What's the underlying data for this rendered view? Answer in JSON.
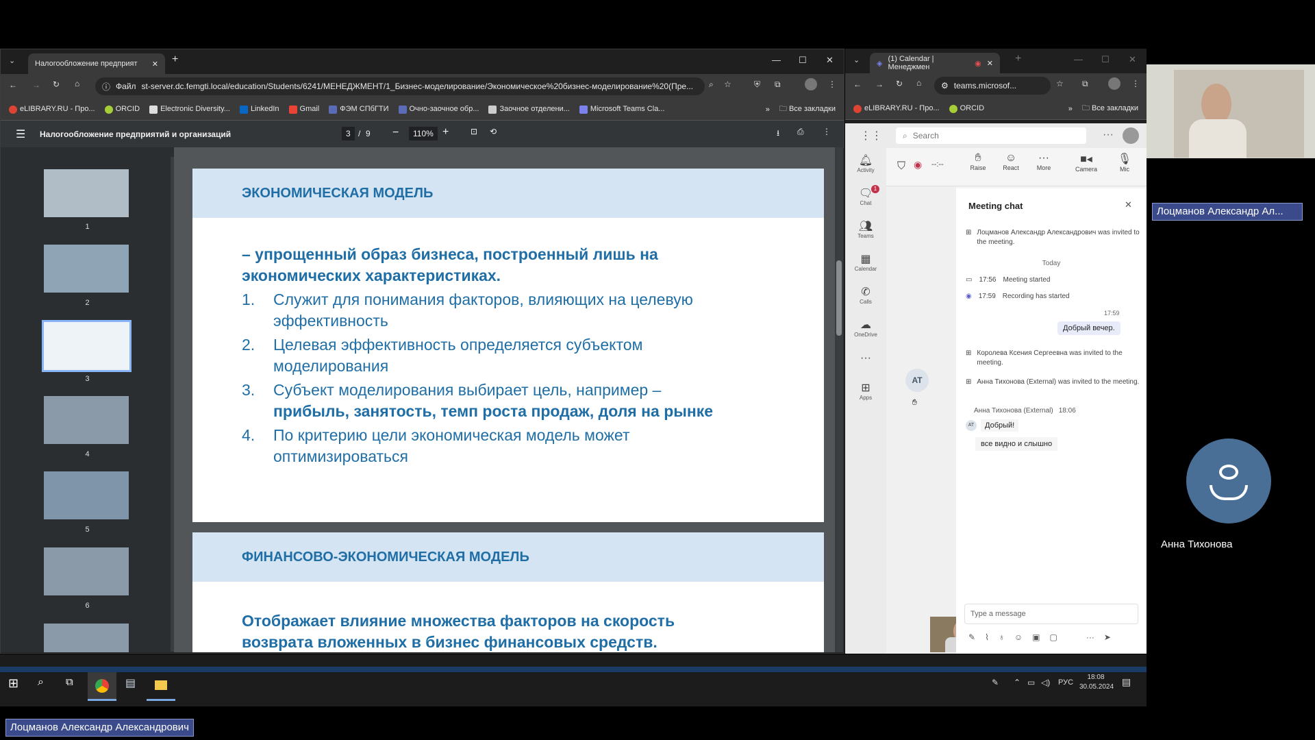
{
  "left_browser": {
    "tab_title": "Налогообложение предприят",
    "address": "st-server.dc.femgti.local/education/Students/6241/МЕНЕДЖМЕНТ/1_Бизнес-моделирование/Экономическое%20бизнес-моделирование%20(Пре...",
    "address_prefix": "Файл",
    "bookmarks": [
      "eLIBRARY.RU - Про...",
      "ORCID",
      "Electronic Diversity...",
      "LinkedIn",
      "Gmail",
      "ФЭМ СПбГТИ",
      "Очно-заочное обр...",
      "Заочное отделени...",
      "Microsoft Teams Cla..."
    ],
    "bookmarks_all": "Все закладки",
    "pdf_title": "Налогообложение предприятий и организаций",
    "page_current": "3",
    "page_total": "9",
    "zoom": "110%",
    "thumb_numbers": [
      "1",
      "2",
      "3",
      "4",
      "5",
      "6"
    ]
  },
  "slide1": {
    "heading": "ЭКОНОМИЧЕСКАЯ МОДЕЛЬ",
    "lead": "– упрощенный образ бизнеса, построенный лишь на экономических характеристиках.",
    "items": [
      {
        "n": "1.",
        "text": "Служит для понимания факторов, влияющих на целевую эффективность"
      },
      {
        "n": "2.",
        "text": "Целевая эффективность определяется субъектом моделирования"
      },
      {
        "n": "3.",
        "text": "Субъект моделирования выбирает цель, например –",
        "bold": "прибыль, занятость, темп роста продаж, доля на рынке"
      },
      {
        "n": "4.",
        "text": "По критерию цели экономическая модель может оптимизироваться"
      }
    ]
  },
  "slide2": {
    "heading": "ФИНАНСОВО-ЭКОНОМИЧЕСКАЯ МОДЕЛЬ",
    "lead": "Отображает влияние множества факторов на скорость возврата вложенных в бизнес финансовых средств."
  },
  "right_browser": {
    "tab_title": "(1) Calendar | Менеджмен",
    "address": "teams.microsof...",
    "bookmarks": [
      "eLIBRARY.RU - Про...",
      "ORCID"
    ],
    "bookmarks_all": "Все закладки"
  },
  "teams": {
    "search_placeholder": "Search",
    "timer": "--:--",
    "rail": [
      "Activity",
      "Chat",
      "Teams",
      "Calendar",
      "Calls",
      "OneDrive",
      "Apps"
    ],
    "chat_badge": "1",
    "toolbar": [
      "Raise",
      "React",
      "More",
      "Camera",
      "Mic"
    ],
    "participant_initials": "AT",
    "chat": {
      "title": "Meeting chat",
      "invite1": "Лоцманов Александр Александрович was invited to the meeting.",
      "today": "Today",
      "ev1_time": "17:56",
      "ev1_text": "Meeting started",
      "ev2_time": "17:59",
      "ev2_text": "Recording has started",
      "my_time": "17:59",
      "my_msg": "Добрый вечер.",
      "invite2": "Королева Ксения Сергеевна was invited to the meeting.",
      "invite3": "Анна Тихонова (External) was invited to the meeting.",
      "sender": "Анна Тихонова (External)",
      "sender_time": "18:06",
      "msg1": "Добрый!",
      "msg2": "все видно и слышно",
      "input_placeholder": "Type a message"
    }
  },
  "side_panel": {
    "presenter_label": "Лоцманов Александр Ал...",
    "participant_name": "Анна Тихонова"
  },
  "taskbar": {
    "lang": "РУС",
    "time": "18:08",
    "date": "30.05.2024"
  },
  "bottom_label": "Лоцманов Александр Александрович",
  "colors": {
    "slide_blue": "#1f6ea6",
    "header_band": "#d4e4f2",
    "avatar": "#4a6f96"
  }
}
